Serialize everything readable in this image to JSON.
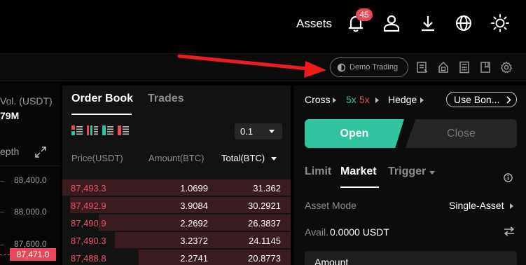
{
  "header": {
    "assets_label": "Assets",
    "notification_count": "45",
    "icons": [
      "bell-icon",
      "user-icon",
      "download-icon",
      "globe-icon",
      "sun-icon"
    ]
  },
  "toolbar": {
    "demo_trading_label": "Demo Trading",
    "icons": [
      "orders-icon",
      "lock-icon",
      "calculator-icon",
      "book-icon",
      "gear-icon"
    ]
  },
  "left_panel": {
    "vol_label": "Vol. (USDT)",
    "vol_value": "79M",
    "depth_label": "epth",
    "y_ticks": [
      "88,400.0",
      "88,000.0",
      "87,600.0"
    ],
    "current_price": "87,471.0"
  },
  "orderbook": {
    "tabs": [
      "Order Book",
      "Trades"
    ],
    "precision": "0.1",
    "col_price": "Price(USDT)",
    "col_amount": "Amount(BTC)",
    "col_total": "Total(BTC)",
    "rows": [
      {
        "price": "87,493.3",
        "amount": "1.0699",
        "total": "31.362",
        "depth": 1.0
      },
      {
        "price": "87,492.9",
        "amount": "3.9084",
        "total": "30.2921",
        "depth": 0.966
      },
      {
        "price": "87,490.9",
        "amount": "2.2692",
        "total": "26.3837",
        "depth": 0.841
      },
      {
        "price": "87,490.3",
        "amount": "3.2372",
        "total": "24.1145",
        "depth": 0.769
      },
      {
        "price": "87,488.8",
        "amount": "2.2741",
        "total": "20.8773",
        "depth": 0.666
      }
    ]
  },
  "trade": {
    "margin_mode": "Cross",
    "leverage_long": "5x",
    "leverage_short": "5x",
    "position_mode": "Hedge",
    "bonus_label": "Use Bon...",
    "open_label": "Open",
    "close_label": "Close",
    "order_tabs": [
      "Limit",
      "Market",
      "Trigger"
    ],
    "asset_mode_label": "Asset Mode",
    "asset_mode_value": "Single-Asset",
    "avail_label": "Avail.",
    "avail_value": "0.0000 USDT",
    "amount_label": "Amount",
    "colors": {
      "accent": "#2fc3a0",
      "ask": "#ef5264",
      "long": "#2fc3a0",
      "short": "#e94a59"
    }
  }
}
